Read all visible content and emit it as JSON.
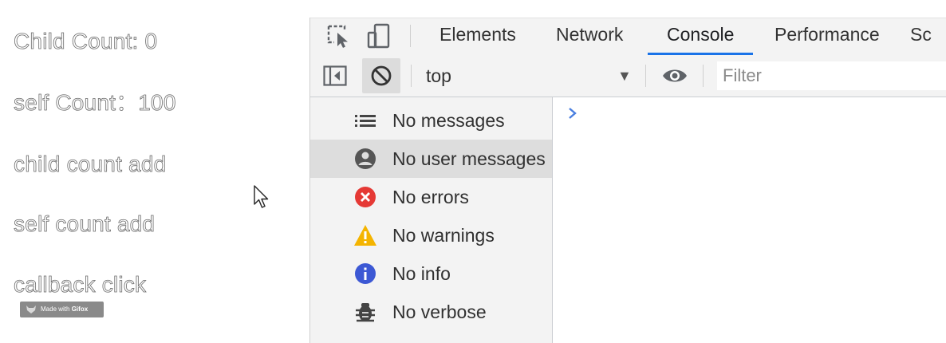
{
  "demo": {
    "lines": [
      "Child Count: 0",
      "self Count：100",
      "child count add",
      "self count add",
      "callback click"
    ],
    "watermark": {
      "prefix": "Made with",
      "brand": "Gifox"
    }
  },
  "devtools": {
    "tabs": [
      "Elements",
      "Network",
      "Console",
      "Performance",
      "Sc"
    ],
    "active_tab": "Console",
    "toolbar": {
      "context": "top",
      "filter_placeholder": "Filter"
    },
    "sidebar_items": [
      {
        "label": "No messages",
        "icon": "list-icon"
      },
      {
        "label": "No user messages",
        "icon": "user-icon",
        "selected": true
      },
      {
        "label": "No errors",
        "icon": "error-icon"
      },
      {
        "label": "No warnings",
        "icon": "warning-icon"
      },
      {
        "label": "No info",
        "icon": "info-icon"
      },
      {
        "label": "No verbose",
        "icon": "bug-icon"
      }
    ],
    "colors": {
      "accent": "#1a73e8",
      "error": "#e53935",
      "warning": "#f4b400",
      "info": "#3c58d4"
    }
  }
}
